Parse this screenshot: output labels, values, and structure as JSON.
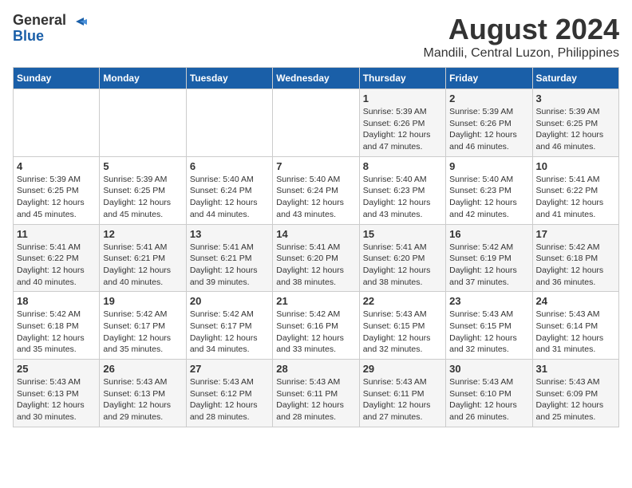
{
  "header": {
    "logo_general": "General",
    "logo_blue": "Blue",
    "title": "August 2024",
    "subtitle": "Mandili, Central Luzon, Philippines"
  },
  "weekdays": [
    "Sunday",
    "Monday",
    "Tuesday",
    "Wednesday",
    "Thursday",
    "Friday",
    "Saturday"
  ],
  "weeks": [
    [
      {
        "day": "",
        "info": ""
      },
      {
        "day": "",
        "info": ""
      },
      {
        "day": "",
        "info": ""
      },
      {
        "day": "",
        "info": ""
      },
      {
        "day": "1",
        "info": "Sunrise: 5:39 AM\nSunset: 6:26 PM\nDaylight: 12 hours\nand 47 minutes."
      },
      {
        "day": "2",
        "info": "Sunrise: 5:39 AM\nSunset: 6:26 PM\nDaylight: 12 hours\nand 46 minutes."
      },
      {
        "day": "3",
        "info": "Sunrise: 5:39 AM\nSunset: 6:25 PM\nDaylight: 12 hours\nand 46 minutes."
      }
    ],
    [
      {
        "day": "4",
        "info": "Sunrise: 5:39 AM\nSunset: 6:25 PM\nDaylight: 12 hours\nand 45 minutes."
      },
      {
        "day": "5",
        "info": "Sunrise: 5:39 AM\nSunset: 6:25 PM\nDaylight: 12 hours\nand 45 minutes."
      },
      {
        "day": "6",
        "info": "Sunrise: 5:40 AM\nSunset: 6:24 PM\nDaylight: 12 hours\nand 44 minutes."
      },
      {
        "day": "7",
        "info": "Sunrise: 5:40 AM\nSunset: 6:24 PM\nDaylight: 12 hours\nand 43 minutes."
      },
      {
        "day": "8",
        "info": "Sunrise: 5:40 AM\nSunset: 6:23 PM\nDaylight: 12 hours\nand 43 minutes."
      },
      {
        "day": "9",
        "info": "Sunrise: 5:40 AM\nSunset: 6:23 PM\nDaylight: 12 hours\nand 42 minutes."
      },
      {
        "day": "10",
        "info": "Sunrise: 5:41 AM\nSunset: 6:22 PM\nDaylight: 12 hours\nand 41 minutes."
      }
    ],
    [
      {
        "day": "11",
        "info": "Sunrise: 5:41 AM\nSunset: 6:22 PM\nDaylight: 12 hours\nand 40 minutes."
      },
      {
        "day": "12",
        "info": "Sunrise: 5:41 AM\nSunset: 6:21 PM\nDaylight: 12 hours\nand 40 minutes."
      },
      {
        "day": "13",
        "info": "Sunrise: 5:41 AM\nSunset: 6:21 PM\nDaylight: 12 hours\nand 39 minutes."
      },
      {
        "day": "14",
        "info": "Sunrise: 5:41 AM\nSunset: 6:20 PM\nDaylight: 12 hours\nand 38 minutes."
      },
      {
        "day": "15",
        "info": "Sunrise: 5:41 AM\nSunset: 6:20 PM\nDaylight: 12 hours\nand 38 minutes."
      },
      {
        "day": "16",
        "info": "Sunrise: 5:42 AM\nSunset: 6:19 PM\nDaylight: 12 hours\nand 37 minutes."
      },
      {
        "day": "17",
        "info": "Sunrise: 5:42 AM\nSunset: 6:18 PM\nDaylight: 12 hours\nand 36 minutes."
      }
    ],
    [
      {
        "day": "18",
        "info": "Sunrise: 5:42 AM\nSunset: 6:18 PM\nDaylight: 12 hours\nand 35 minutes."
      },
      {
        "day": "19",
        "info": "Sunrise: 5:42 AM\nSunset: 6:17 PM\nDaylight: 12 hours\nand 35 minutes."
      },
      {
        "day": "20",
        "info": "Sunrise: 5:42 AM\nSunset: 6:17 PM\nDaylight: 12 hours\nand 34 minutes."
      },
      {
        "day": "21",
        "info": "Sunrise: 5:42 AM\nSunset: 6:16 PM\nDaylight: 12 hours\nand 33 minutes."
      },
      {
        "day": "22",
        "info": "Sunrise: 5:43 AM\nSunset: 6:15 PM\nDaylight: 12 hours\nand 32 minutes."
      },
      {
        "day": "23",
        "info": "Sunrise: 5:43 AM\nSunset: 6:15 PM\nDaylight: 12 hours\nand 32 minutes."
      },
      {
        "day": "24",
        "info": "Sunrise: 5:43 AM\nSunset: 6:14 PM\nDaylight: 12 hours\nand 31 minutes."
      }
    ],
    [
      {
        "day": "25",
        "info": "Sunrise: 5:43 AM\nSunset: 6:13 PM\nDaylight: 12 hours\nand 30 minutes."
      },
      {
        "day": "26",
        "info": "Sunrise: 5:43 AM\nSunset: 6:13 PM\nDaylight: 12 hours\nand 29 minutes."
      },
      {
        "day": "27",
        "info": "Sunrise: 5:43 AM\nSunset: 6:12 PM\nDaylight: 12 hours\nand 28 minutes."
      },
      {
        "day": "28",
        "info": "Sunrise: 5:43 AM\nSunset: 6:11 PM\nDaylight: 12 hours\nand 28 minutes."
      },
      {
        "day": "29",
        "info": "Sunrise: 5:43 AM\nSunset: 6:11 PM\nDaylight: 12 hours\nand 27 minutes."
      },
      {
        "day": "30",
        "info": "Sunrise: 5:43 AM\nSunset: 6:10 PM\nDaylight: 12 hours\nand 26 minutes."
      },
      {
        "day": "31",
        "info": "Sunrise: 5:43 AM\nSunset: 6:09 PM\nDaylight: 12 hours\nand 25 minutes."
      }
    ]
  ]
}
